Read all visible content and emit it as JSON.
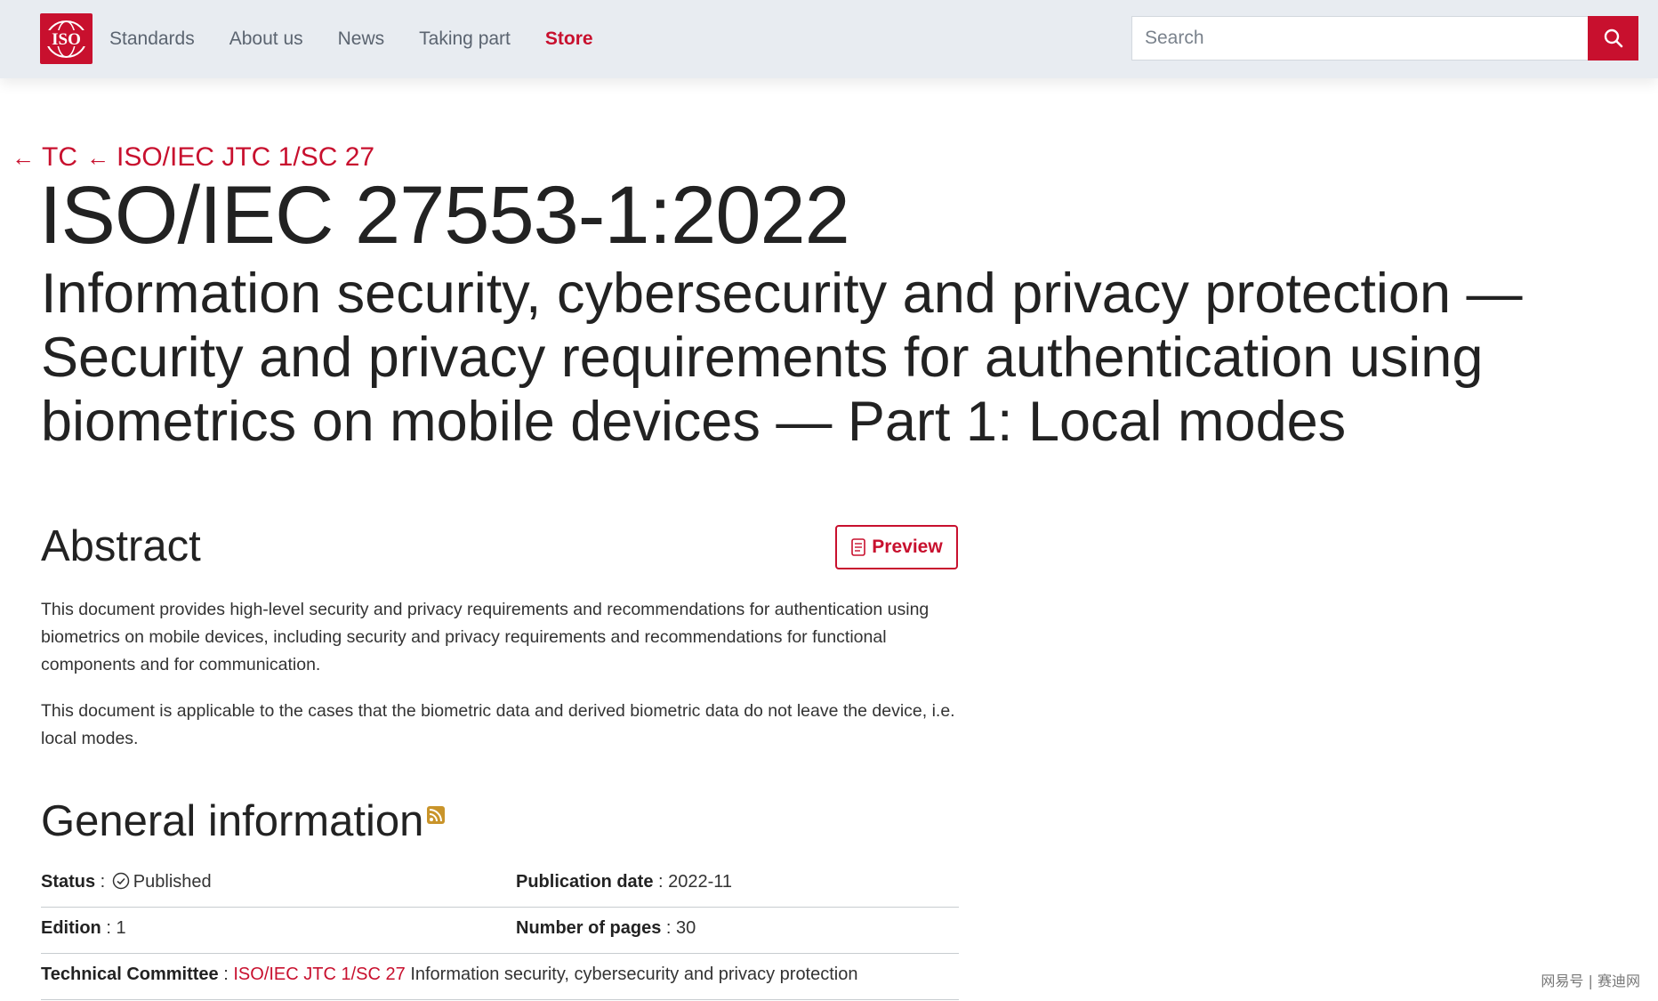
{
  "header": {
    "logo_text": "ISO",
    "nav": [
      {
        "label": "Standards"
      },
      {
        "label": "About us"
      },
      {
        "label": "News"
      },
      {
        "label": "Taking part"
      },
      {
        "label": "Store"
      }
    ],
    "search": {
      "placeholder": "Search",
      "value": ""
    },
    "accent_color": "#c8102e"
  },
  "breadcrumb": [
    {
      "label": "TC"
    },
    {
      "label": "ISO/IEC JTC 1/SC 27"
    }
  ],
  "standard": {
    "reference": "ISO/IEC 27553-1:2022",
    "title": "Information security, cybersecurity and privacy protection — Security and privacy requirements for authentication using biometrics on mobile devices — Part 1: Local modes"
  },
  "abstract": {
    "heading": "Abstract",
    "preview_label": "Preview",
    "paragraphs": [
      "This document provides high-level security and privacy requirements and recommendations for authentication using biometrics on mobile devices, including security and privacy requirements and recommendations for functional components and for communication.",
      "This document is applicable to the cases that the biometric data and derived biometric data do not leave the device, i.e. local modes."
    ]
  },
  "general_info": {
    "heading": "General information",
    "status_label": "Status",
    "status_value": "Published",
    "pub_date_label": "Publication date",
    "pub_date_value": "2022-11",
    "edition_label": "Edition",
    "edition_value": "1",
    "pages_label": "Number of pages",
    "pages_value": "30",
    "tc_label": "Technical Committee",
    "tc_link": "ISO/IEC JTC 1/SC 27",
    "tc_name": "Information security, cybersecurity and privacy protection"
  },
  "watermark": "网易号 | 赛迪网"
}
